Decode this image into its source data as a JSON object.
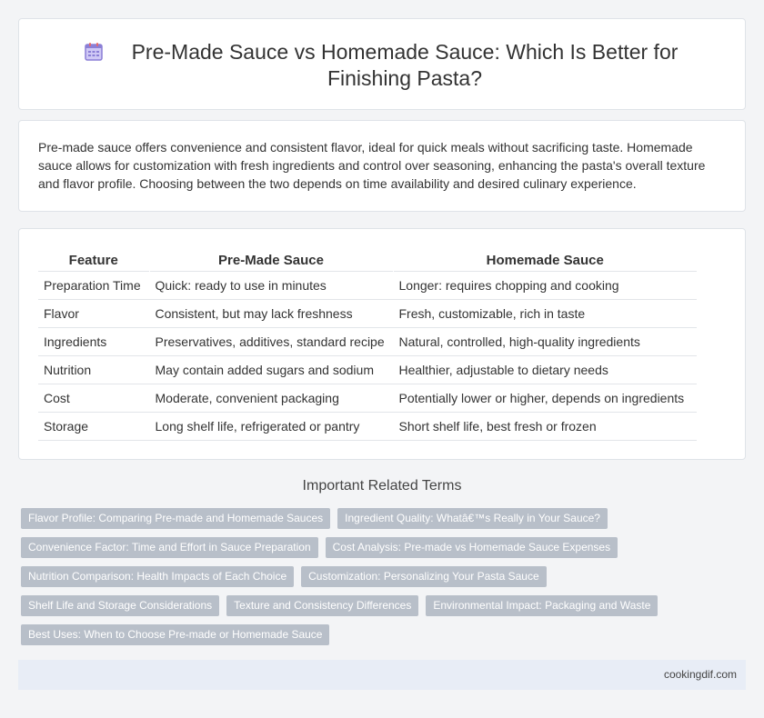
{
  "header": {
    "title": "Pre-Made Sauce vs Homemade Sauce: Which Is Better for Finishing Pasta?",
    "icon": "calendar-icon"
  },
  "intro": {
    "text": "Pre-made sauce offers convenience and consistent flavor, ideal for quick meals without sacrificing taste. Homemade sauce allows for customization with fresh ingredients and control over seasoning, enhancing the pasta's overall texture and flavor profile. Choosing between the two depends on time availability and desired culinary experience."
  },
  "comparison": {
    "headers": [
      "Feature",
      "Pre-Made Sauce",
      "Homemade Sauce"
    ],
    "rows": [
      [
        "Preparation Time",
        "Quick: ready to use in minutes",
        "Longer: requires chopping and cooking"
      ],
      [
        "Flavor",
        "Consistent, but may lack freshness",
        "Fresh, customizable, rich in taste"
      ],
      [
        "Ingredients",
        "Preservatives, additives, standard recipe",
        "Natural, controlled, high-quality ingredients"
      ],
      [
        "Nutrition",
        "May contain added sugars and sodium",
        "Healthier, adjustable to dietary needs"
      ],
      [
        "Cost",
        "Moderate, convenient packaging",
        "Potentially lower or higher, depends on ingredients"
      ],
      [
        "Storage",
        "Long shelf life, refrigerated or pantry",
        "Short shelf life, best fresh or frozen"
      ]
    ]
  },
  "terms": {
    "heading": "Important Related Terms",
    "tags": [
      "Flavor Profile: Comparing Pre-made and Homemade Sauces",
      "Ingredient Quality: Whatâ€™s Really in Your Sauce?",
      "Convenience Factor: Time and Effort in Sauce Preparation",
      "Cost Analysis: Pre-made vs Homemade Sauce Expenses",
      "Nutrition Comparison: Health Impacts of Each Choice",
      "Customization: Personalizing Your Pasta Sauce",
      "Shelf Life and Storage Considerations",
      "Texture and Consistency Differences",
      "Environmental Impact: Packaging and Waste",
      "Best Uses: When to Choose Pre-made or Homemade Sauce"
    ]
  },
  "footer": {
    "site": "cookingdif.com"
  },
  "colors": {
    "tag_bg": "#b8bfc9",
    "footer_bg": "#e8edf6",
    "icon_purple": "#8b7fd6",
    "icon_red": "#e86a6a"
  }
}
